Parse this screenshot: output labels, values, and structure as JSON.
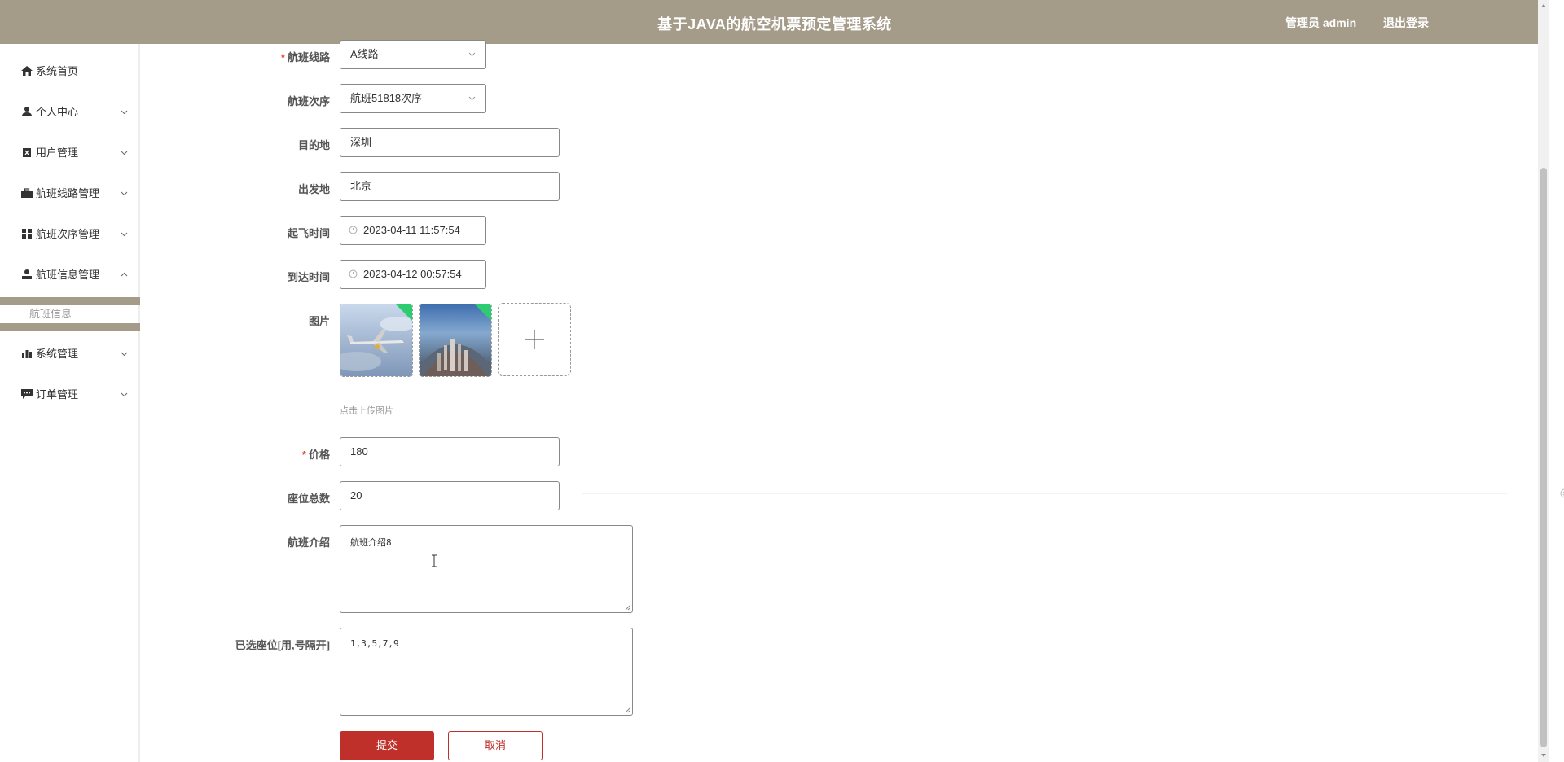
{
  "header": {
    "title": "基于JAVA的航空机票预定管理系统",
    "user": "管理员 admin",
    "logout": "退出登录"
  },
  "sidebar": {
    "items": [
      {
        "label": "系统首页",
        "icon": "home-icon"
      },
      {
        "label": "个人中心",
        "icon": "user-icon"
      },
      {
        "label": "用户管理",
        "icon": "clipboard-icon"
      },
      {
        "label": "航班线路管理",
        "icon": "briefcase-icon"
      },
      {
        "label": "航班次序管理",
        "icon": "grid-icon"
      },
      {
        "label": "航班信息管理",
        "icon": "person-icon"
      },
      {
        "label": "系统管理",
        "icon": "bar-chart-icon"
      },
      {
        "label": "订单管理",
        "icon": "chat-icon"
      }
    ],
    "active_sub": "航班信息"
  },
  "form": {
    "route_label": "航班线路",
    "route_value": "A线路",
    "order_label": "航班次序",
    "order_value": "航班51818次序",
    "destination_label": "目的地",
    "destination_value": "深圳",
    "origin_label": "出发地",
    "origin_value": "北京",
    "takeoff_label": "起飞时间",
    "takeoff_value": "2023-04-11 11:57:54",
    "arrival_label": "到达时间",
    "arrival_value": "2023-04-12 00:57:54",
    "image_label": "图片",
    "image_hint": "点击上传图片",
    "price_label": "价格",
    "price_value": "180",
    "seats_label": "座位总数",
    "seats_value": "20",
    "intro_label": "航班介绍",
    "intro_value": "航班介绍8",
    "selected_label": "已选座位[用,号隔开]",
    "selected_value": "1,3,5,7,9",
    "submit": "提交",
    "cancel": "取消"
  },
  "colors": {
    "header_bg": "#a59b89",
    "primary": "#c0302b",
    "required": "#e74c3c"
  }
}
